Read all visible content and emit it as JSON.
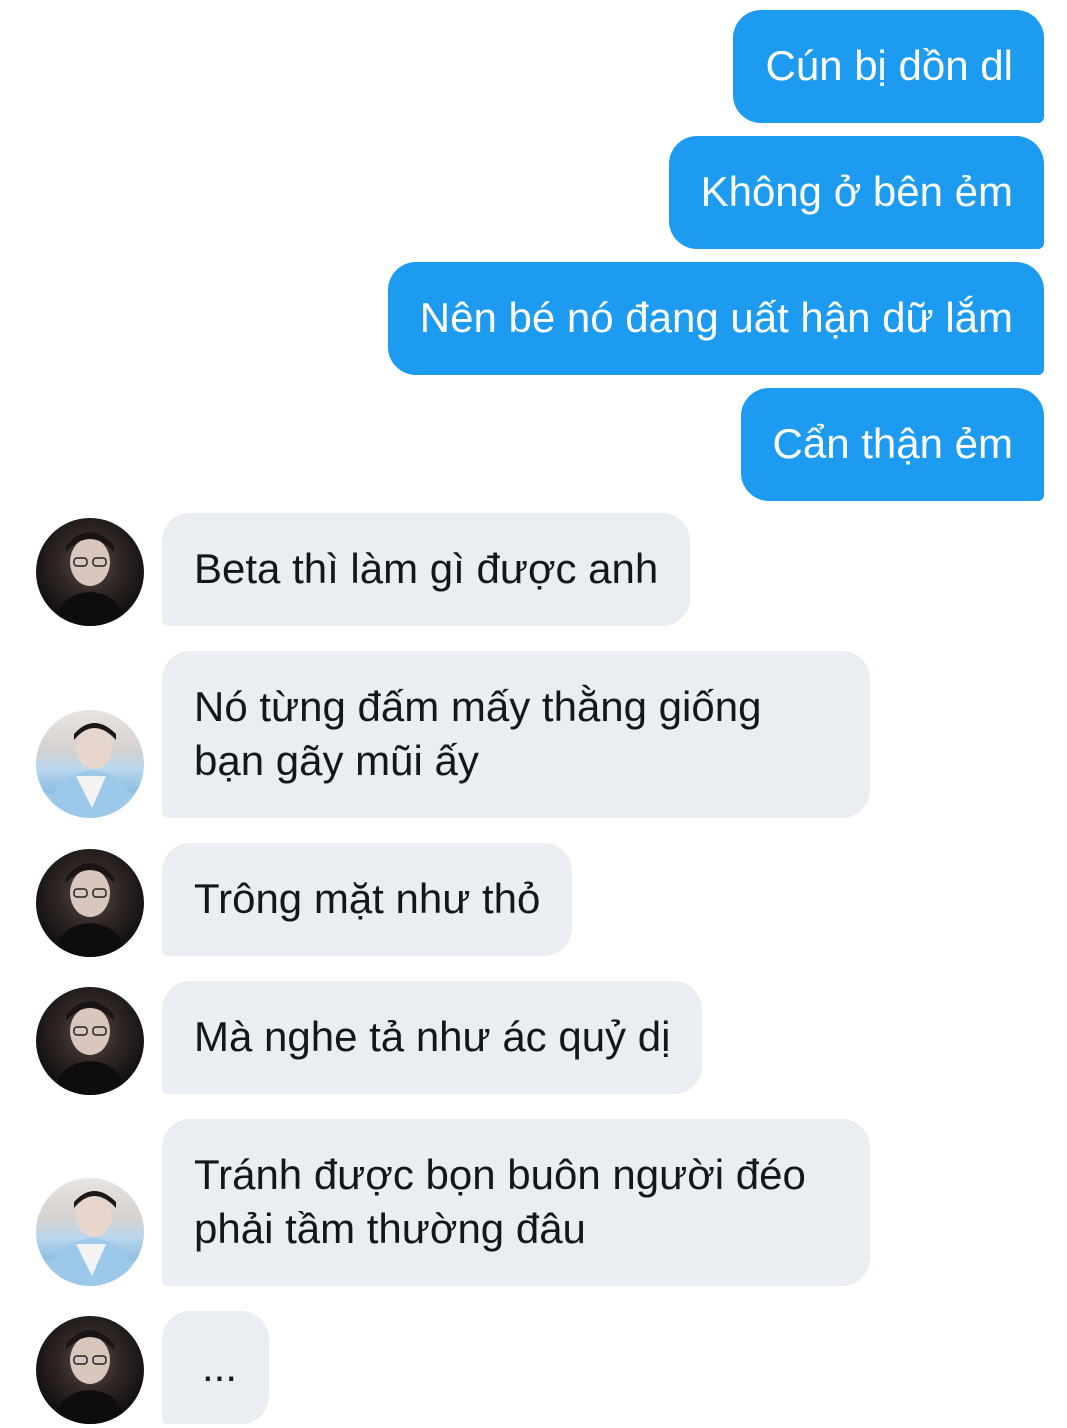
{
  "conversation": {
    "messages": [
      {
        "side": "out",
        "text": "Cún bị dồn dl"
      },
      {
        "side": "out",
        "text": "Không ở bên ẻm"
      },
      {
        "side": "out",
        "text": "Nên bé nó đang uất hận dữ lắm"
      },
      {
        "side": "out",
        "text": "Cẩn thận ẻm"
      },
      {
        "side": "in",
        "avatar": "avatar-dark-portrait",
        "text": "Beta thì làm gì được anh"
      },
      {
        "side": "in",
        "avatar": "avatar-hanbok-portrait",
        "text": "Nó từng đấm mấy thằng giống bạn gãy mũi ấy"
      },
      {
        "side": "in",
        "avatar": "avatar-dark-portrait",
        "text": "Trông mặt như thỏ"
      },
      {
        "side": "in",
        "avatar": "avatar-dark-portrait",
        "text": "Mà nghe tả như ác quỷ dị"
      },
      {
        "side": "in",
        "avatar": "avatar-hanbok-portrait",
        "text": "Tránh được bọn buôn người đéo phải tầm thường đâu"
      },
      {
        "side": "in",
        "avatar": "avatar-dark-portrait",
        "text": "..."
      }
    ]
  },
  "colors": {
    "outgoing_bubble": "#1d9bf0",
    "incoming_bubble": "#eaedf1",
    "outgoing_text": "#ffffff",
    "incoming_text": "#14171a"
  }
}
